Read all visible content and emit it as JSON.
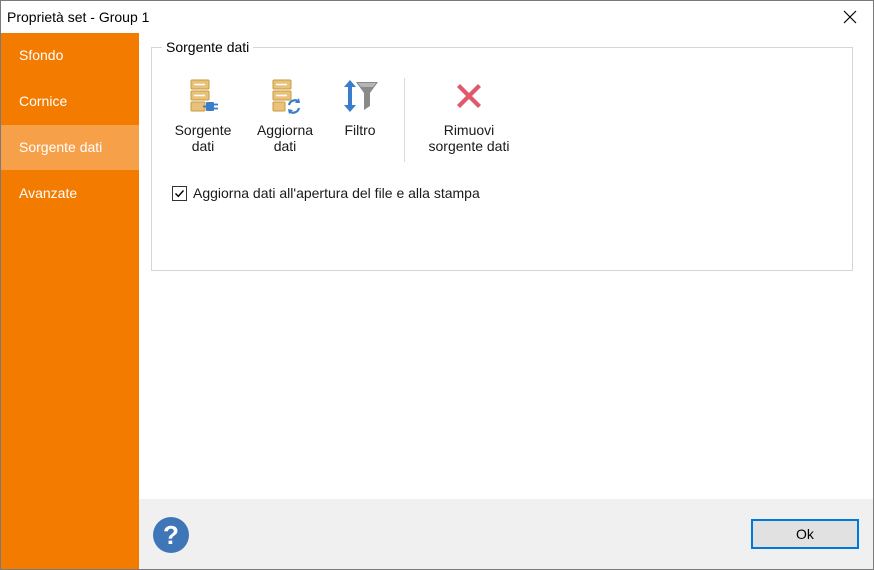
{
  "window": {
    "title": "Proprietà set - Group 1"
  },
  "sidebar": {
    "items": [
      {
        "label": "Sfondo"
      },
      {
        "label": "Cornice"
      },
      {
        "label": "Sorgente dati",
        "active": true
      },
      {
        "label": "Avanzate"
      }
    ]
  },
  "group": {
    "title": "Sorgente dati",
    "buttons": {
      "source": {
        "label": "Sorgente\ndati",
        "icon": "data-source-icon"
      },
      "refresh": {
        "label": "Aggiorna\ndati",
        "icon": "refresh-data-icon"
      },
      "filter": {
        "label": "Filtro",
        "icon": "filter-icon"
      },
      "remove": {
        "label": "Rimuovi\nsorgente dati",
        "icon": "remove-icon"
      }
    },
    "checkbox": {
      "label": "Aggiorna dati all'apertura del file e alla stampa",
      "checked": true
    }
  },
  "footer": {
    "help": "?",
    "ok_label": "Ok"
  },
  "colors": {
    "sidebar": "#f37b00",
    "sidebar_active": "#f6a04a",
    "accent": "#0078d7",
    "help": "#3f76b8",
    "remove": "#e05a6a"
  }
}
